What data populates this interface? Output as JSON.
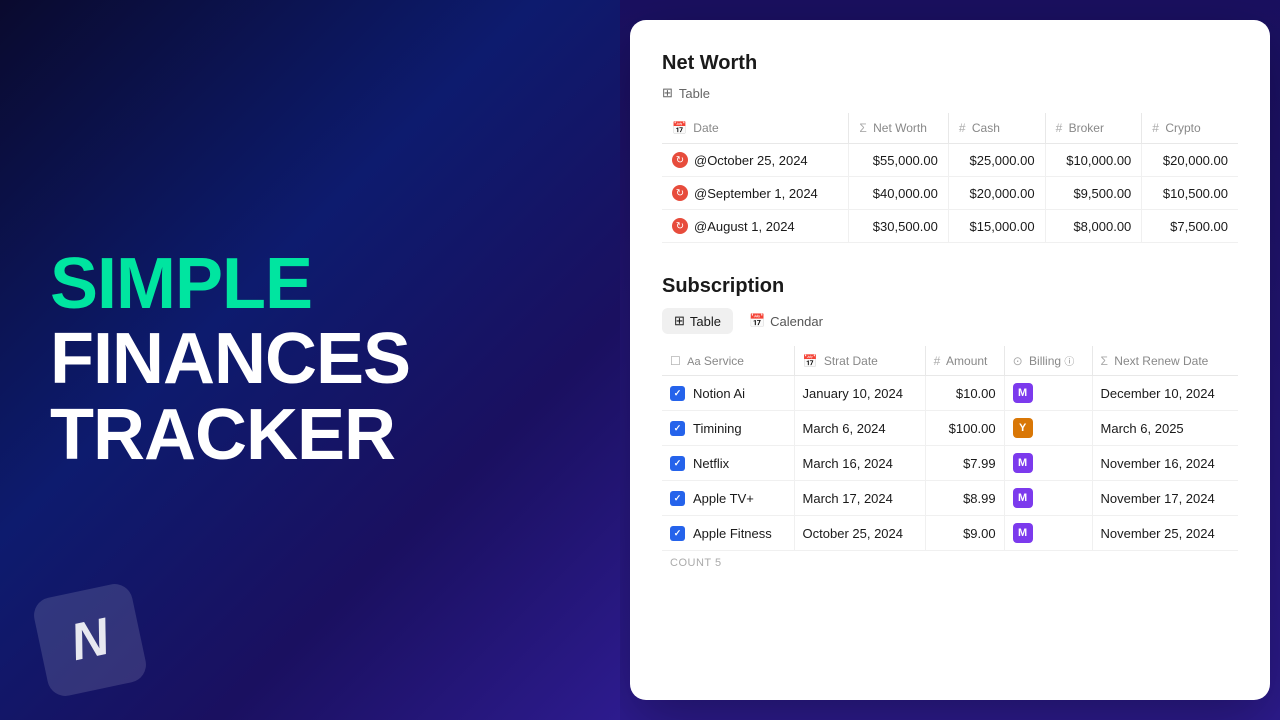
{
  "left": {
    "title_line1": "SIMPLE",
    "title_line2": "FINANCES",
    "title_line3": "TRACKER"
  },
  "netWorth": {
    "sectionTitle": "Net Worth",
    "tableLabel": "Table",
    "columns": [
      {
        "icon": "📅",
        "label": "Date"
      },
      {
        "icon": "Σ",
        "label": "Net Worth"
      },
      {
        "icon": "#",
        "label": "Cash"
      },
      {
        "icon": "#",
        "label": "Broker"
      },
      {
        "icon": "#",
        "label": "Crypto"
      }
    ],
    "rows": [
      {
        "date": "@October 25, 2024",
        "netWorth": "$55,000.00",
        "cash": "$25,000.00",
        "broker": "$10,000.00",
        "crypto": "$20,000.00"
      },
      {
        "date": "@September 1, 2024",
        "netWorth": "$40,000.00",
        "cash": "$20,000.00",
        "broker": "$9,500.00",
        "crypto": "$10,500.00"
      },
      {
        "date": "@August 1, 2024",
        "netWorth": "$30,500.00",
        "cash": "$15,000.00",
        "broker": "$8,000.00",
        "crypto": "$7,500.00"
      }
    ]
  },
  "subscription": {
    "sectionTitle": "Subscription",
    "tabs": [
      {
        "label": "Table",
        "active": true
      },
      {
        "label": "Calendar",
        "active": false
      }
    ],
    "columns": [
      {
        "icon": "☐",
        "label": "Service"
      },
      {
        "icon": "📅",
        "label": "Strat Date"
      },
      {
        "icon": "#",
        "label": "Amount"
      },
      {
        "icon": "⊙",
        "label": "Billing"
      },
      {
        "icon": "Σ",
        "label": "Next Renew Date"
      }
    ],
    "rows": [
      {
        "service": "Notion Ai",
        "startDate": "January 10, 2024",
        "amount": "$10.00",
        "billing": "M",
        "billingClass": "billing-m",
        "renewDate": "December 10, 2024"
      },
      {
        "service": "Timining",
        "startDate": "March 6, 2024",
        "amount": "$100.00",
        "billing": "Y",
        "billingClass": "billing-y",
        "renewDate": "March 6, 2025"
      },
      {
        "service": "Netflix",
        "startDate": "March 16, 2024",
        "amount": "$7.99",
        "billing": "M",
        "billingClass": "billing-m",
        "renewDate": "November 16, 2024"
      },
      {
        "service": "Apple TV+",
        "startDate": "March 17, 2024",
        "amount": "$8.99",
        "billing": "M",
        "billingClass": "billing-m",
        "renewDate": "November 17, 2024"
      },
      {
        "service": "Apple Fitness",
        "startDate": "October 25, 2024",
        "amount": "$9.00",
        "billing": "M",
        "billingClass": "billing-m",
        "renewDate": "November 25, 2024"
      }
    ],
    "countLabel": "COUNT",
    "countValue": "5"
  }
}
